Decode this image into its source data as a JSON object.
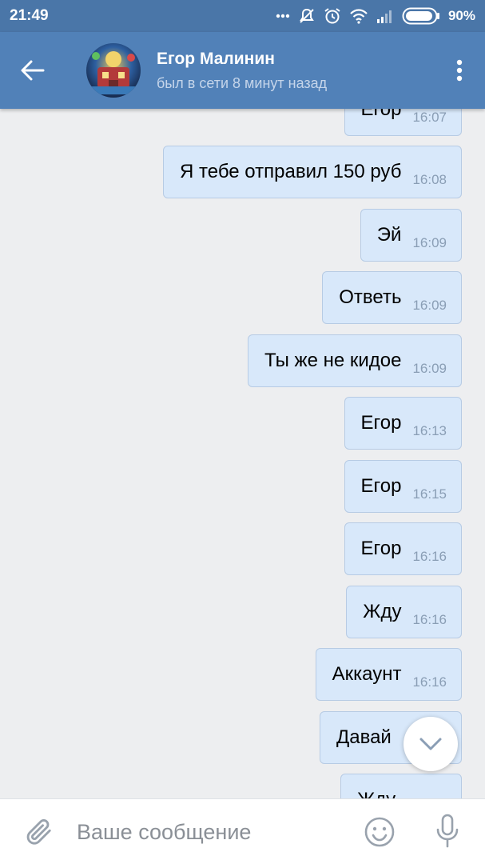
{
  "status_bar": {
    "time": "21:49",
    "battery": "90%",
    "icons": [
      "dots-icon",
      "mute-icon",
      "alarm-icon",
      "wifi-icon",
      "signal-icon",
      "battery-icon"
    ]
  },
  "header": {
    "name": "Егор Малинин",
    "status": "был в сети 8 минут назад",
    "back_icon": "back-arrow-icon",
    "menu_icon": "more-vertical-icon"
  },
  "messages": [
    {
      "text": "Егор",
      "time": "16:07"
    },
    {
      "text": "Я тебе отправил 150 руб",
      "time": "16:08"
    },
    {
      "text": "Эй",
      "time": "16:09"
    },
    {
      "text": "Ответь",
      "time": "16:09"
    },
    {
      "text": "Ты же не кидое",
      "time": "16:09"
    },
    {
      "text": "Егор",
      "time": "16:13"
    },
    {
      "text": "Егор",
      "time": "16:15"
    },
    {
      "text": "Егор",
      "time": "16:16"
    },
    {
      "text": "Жду",
      "time": "16:16"
    },
    {
      "text": "Аккаунт",
      "time": "16:16"
    },
    {
      "text": "Давай",
      "time": ""
    },
    {
      "text": "Жду",
      "time": ""
    }
  ],
  "composer": {
    "placeholder": "Ваше сообщение",
    "value": ""
  },
  "colors": {
    "header": "#5181b8",
    "status_bar": "#4a76a8",
    "bubble": "#d8e8fa",
    "background": "#edeef0"
  }
}
